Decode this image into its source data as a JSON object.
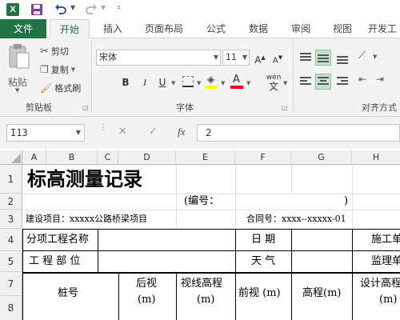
{
  "app": {
    "name": "Excel"
  },
  "tabs": [
    {
      "label": "文件",
      "kind": "file"
    },
    {
      "label": "开始",
      "kind": "active"
    },
    {
      "label": "插入"
    },
    {
      "label": "页面布局"
    },
    {
      "label": "公式"
    },
    {
      "label": "数据"
    },
    {
      "label": "审阅"
    },
    {
      "label": "视图"
    },
    {
      "label": "开发工"
    }
  ],
  "ribbon": {
    "clipboard": {
      "paste": "粘贴",
      "cut": "剪切",
      "copy": "复制",
      "format_painter": "格式刷",
      "group_label": "剪贴板"
    },
    "font": {
      "name": "宋体",
      "size": "11",
      "bold": "B",
      "italic": "I",
      "underline": "U",
      "wen": "wén",
      "group_label": "字体"
    },
    "align": {
      "group_label": "对齐方式"
    }
  },
  "formula_bar": {
    "name_box": "I13",
    "cancel": "✕",
    "enter": "✓",
    "fx": "fx",
    "value": "2"
  },
  "columns": [
    "A",
    "B",
    "C",
    "D",
    "E",
    "F",
    "G",
    "H"
  ],
  "rows": [
    "1",
    "2",
    "3",
    "4",
    "5",
    "7",
    "8"
  ],
  "sheet": {
    "title": "标高测量记录",
    "serial_label": "(编号：",
    "serial_close": ")",
    "project_label": "建设项目：xxxxx公路桥梁项目",
    "contract_label": "合同号：xxxx--xxxxx-01",
    "subproject_label": "分项工程名称",
    "date_label": "日  期",
    "contractor_label": "施工单",
    "location_label": "工 程 部 位",
    "weather_label": "天  气",
    "supervisor_label": "监理单",
    "headers": {
      "station": "桩号",
      "backsight": "后视",
      "backsight_unit": "(m)",
      "hi": "视线高程",
      "hi_unit": "(m)",
      "foresight": "前视 (m)",
      "elevation": "高程(m)",
      "design_elev": "设计高程",
      "design_unit": "(m)"
    }
  },
  "colors": {
    "excel_green": "#217346",
    "ribbon_bg": "#f3f3f3",
    "highlight": "#ffff00",
    "font_red": "#ff0000"
  }
}
